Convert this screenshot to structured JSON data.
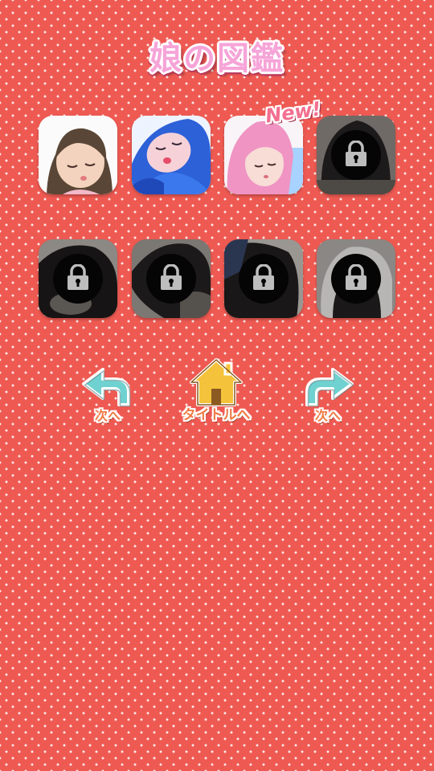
{
  "header": {
    "title": "娘の図鑑",
    "new_badge": "New!"
  },
  "gallery": {
    "cards": [
      {
        "state": "unlocked",
        "hair": "#5a4636",
        "skin": "#f3d3bd",
        "bg": "#ffffff",
        "accent": "#f2b9c9",
        "icon": "sleeping-girl-brown-hair"
      },
      {
        "state": "unlocked",
        "hair": "#2d61d8",
        "skin": "#f6d2d8",
        "bg": "#eef4ff",
        "accent": "#9ec8ff",
        "icon": "sleeping-girl-blue-hair"
      },
      {
        "state": "unlocked",
        "hair": "#ef94c3",
        "skin": "#f8dcd6",
        "bg": "#f9f4f8",
        "accent": "#a8d2ff",
        "icon": "sleeping-girl-pink-hair"
      },
      {
        "state": "locked",
        "icon": "lock-icon"
      },
      {
        "state": "locked",
        "icon": "lock-icon"
      },
      {
        "state": "locked",
        "icon": "lock-icon"
      },
      {
        "state": "locked",
        "icon": "lock-icon"
      },
      {
        "state": "locked",
        "icon": "lock-icon"
      }
    ]
  },
  "navigation": {
    "prev_label": "次へ",
    "title_label": "タイトルへ",
    "next_label": "次へ",
    "prev_icon": "curved-arrow-left-icon",
    "title_icon": "house-icon",
    "next_icon": "curved-arrow-right-icon"
  },
  "colors": {
    "background": "#ee5a52",
    "arrow": "#6fd2d0",
    "house": "#f5c33b",
    "label": "#f07a44",
    "title": "#f6a4d8"
  }
}
